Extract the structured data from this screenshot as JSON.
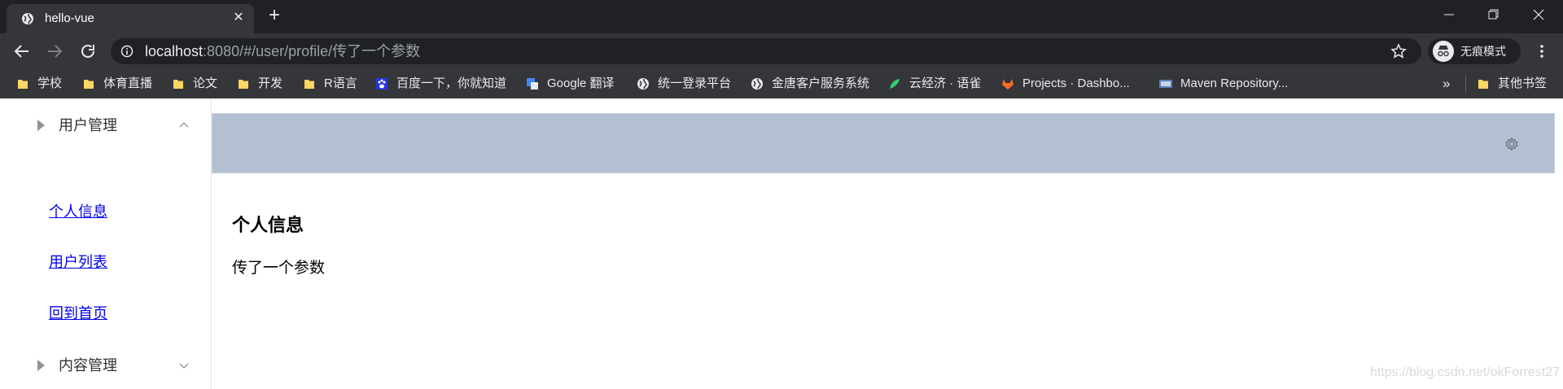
{
  "browser": {
    "tab": {
      "title": "hello-vue",
      "close_glyph": "✕",
      "favicon": "globe-icon"
    },
    "new_tab_glyph": "+",
    "window_controls": [
      "minimize-icon",
      "restore-icon",
      "close-icon"
    ],
    "toolbar": {
      "url_host": "localhost",
      "url_rest": ":8080/#/user/profile/传了一个参数",
      "incognito_label": "无痕模式"
    },
    "bookmarks": [
      {
        "label": "学校",
        "icon": "folder-icon"
      },
      {
        "label": "体育直播",
        "icon": "folder-icon"
      },
      {
        "label": "论文",
        "icon": "folder-icon"
      },
      {
        "label": "开发",
        "icon": "folder-icon"
      },
      {
        "label": "R语言",
        "icon": "folder-icon"
      },
      {
        "label": "百度一下，你就知道",
        "icon": "baidu-icon"
      },
      {
        "label": "Google 翻译",
        "icon": "google-translate-icon"
      },
      {
        "label": "统一登录平台",
        "icon": "globe-icon"
      },
      {
        "label": "金唐客户服务系统",
        "icon": "globe-icon"
      },
      {
        "label": "云经济 · 语雀",
        "icon": "yuque-icon"
      },
      {
        "label": "Projects · Dashbo...",
        "icon": "gitlab-icon"
      },
      {
        "label": "Maven Repository...",
        "icon": "maven-icon"
      }
    ],
    "bookmarks_more": "»",
    "other_bookmarks": "其他书签"
  },
  "sidebar": {
    "user_menu": {
      "label": "用户管理",
      "expanded": true
    },
    "links": [
      "个人信息",
      "用户列表",
      "回到首页"
    ],
    "content_menu": {
      "label": "内容管理",
      "expanded": false
    }
  },
  "header": {
    "settings_icon": "gear-icon"
  },
  "main": {
    "title": "个人信息",
    "param": "传了一个参数"
  },
  "watermark": "https://blog.csdn.net/okForrest27",
  "colors": {
    "header_bg": "#b3c0d1",
    "link": "#0000ee",
    "chrome_dark": "#202124",
    "chrome_toolbar": "#35363a"
  }
}
